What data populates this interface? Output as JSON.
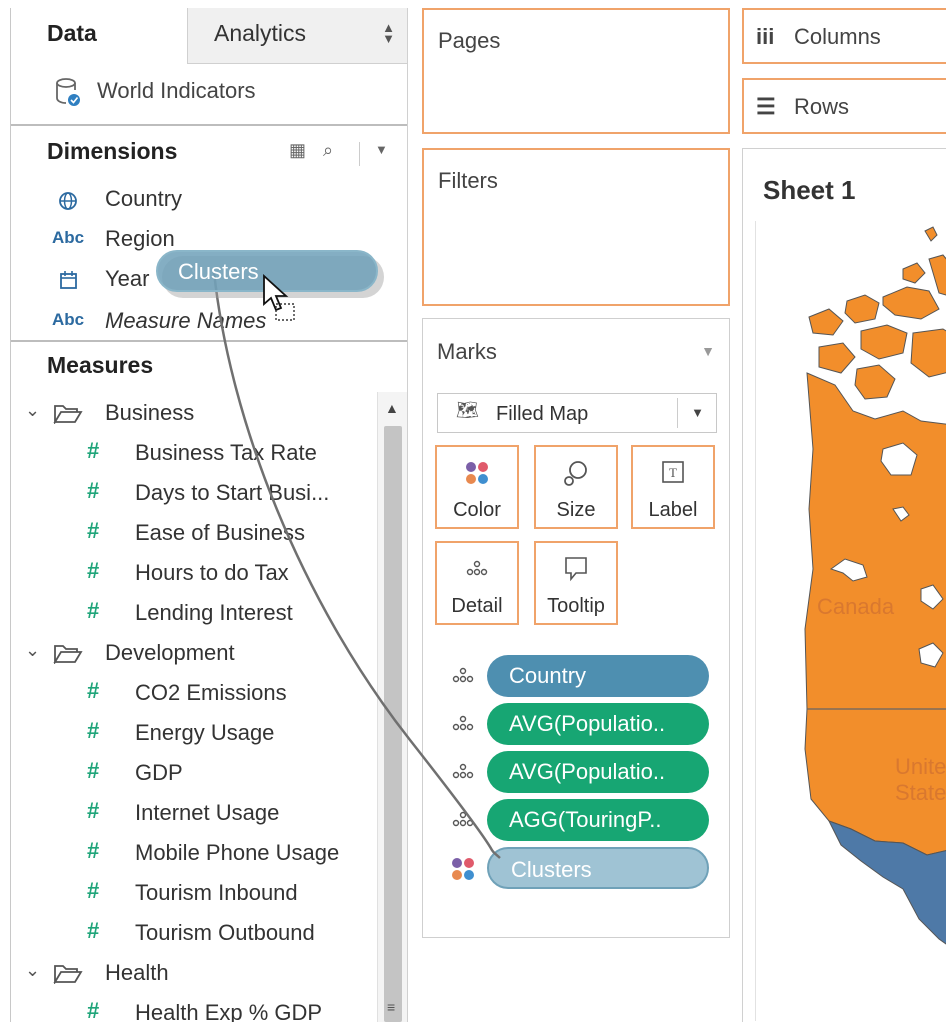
{
  "left_pane": {
    "tabs": {
      "data": "Data",
      "analytics": "Analytics"
    },
    "datasource": "World Indicators",
    "dimensions_title": "Dimensions",
    "dimensions": [
      {
        "icon": "globe-icon",
        "label": "Country"
      },
      {
        "icon": "abc-icon",
        "badge": "Abc",
        "label": "Region"
      },
      {
        "icon": "calendar-icon",
        "label": "Year"
      },
      {
        "icon": "abc-icon",
        "badge": "Abc",
        "label": "Measure Names"
      }
    ],
    "measures_title": "Measures",
    "folders": [
      {
        "label": "Business",
        "items": [
          "Business Tax Rate",
          "Days to Start Busi...",
          "Ease of Business",
          "Hours to do Tax",
          "Lending Interest"
        ]
      },
      {
        "label": "Development",
        "items": [
          "CO2 Emissions",
          "Energy Usage",
          "GDP",
          "Internet Usage",
          "Mobile Phone Usage",
          "Tourism Inbound",
          "Tourism Outbound"
        ]
      },
      {
        "label": "Health",
        "items": [
          "Health Exp % GDP"
        ]
      }
    ]
  },
  "shelves": {
    "pages": "Pages",
    "filters": "Filters",
    "columns": "Columns",
    "rows": "Rows"
  },
  "marks": {
    "title": "Marks",
    "mark_type": "Filled Map",
    "buttons": {
      "color": "Color",
      "size": "Size",
      "label": "Label",
      "detail": "Detail",
      "tooltip": "Tooltip"
    },
    "pills": [
      {
        "label": "Country",
        "kind": "detail",
        "color": "#4e8fb0"
      },
      {
        "label": "AVG(Populatio..",
        "kind": "detail",
        "color": "#17a673"
      },
      {
        "label": "AVG(Populatio..",
        "kind": "detail",
        "color": "#17a673"
      },
      {
        "label": "AGG(TouringP..",
        "kind": "detail",
        "color": "#17a673"
      },
      {
        "label": "Clusters",
        "kind": "color",
        "color": "#9fc3d4"
      }
    ]
  },
  "view": {
    "sheet_title": "Sheet 1",
    "map_labels": [
      "Canada",
      "Unite",
      "State"
    ],
    "colors": {
      "cluster_orange": "#f28e2b",
      "cluster_blue": "#4e79a7"
    }
  },
  "drag": {
    "label": "Clusters"
  },
  "colors": {
    "shelf_border": "#f0a36a",
    "dimension_blue": "#4e8fb0",
    "measure_green": "#17a673"
  }
}
